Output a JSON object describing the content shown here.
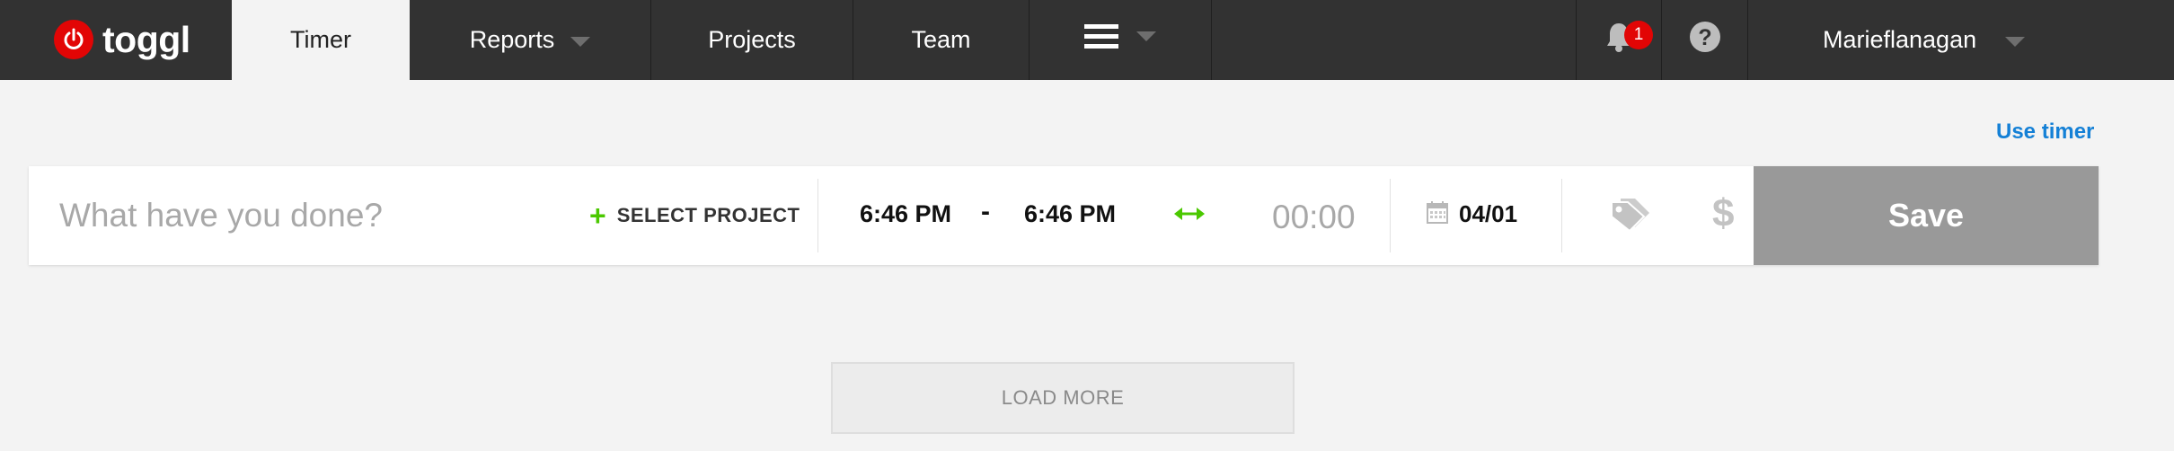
{
  "brand": {
    "name": "toggl",
    "logo_icon": "power-icon",
    "accent": "#e20505"
  },
  "nav": {
    "timer": "Timer",
    "reports": "Reports",
    "projects": "Projects",
    "team": "Team",
    "menu_icon": "hamburger-icon",
    "notifications_icon": "bell-icon",
    "notifications_count": "1",
    "help_icon": "question-icon",
    "user": "Marieflanagan"
  },
  "entry": {
    "use_timer_label": "Use timer",
    "description_placeholder": "What have you done?",
    "description_value": "",
    "select_project_label": "SELECT PROJECT",
    "start_time": "6:46 PM",
    "separator": "-",
    "end_time": "6:46 PM",
    "duration": "00:00",
    "date": "04/01",
    "save_label": "Save",
    "billable_label": "$"
  },
  "load_more_label": "LOAD MORE",
  "colors": {
    "nav_bg": "#323232",
    "link": "#1480d6",
    "green": "#4bc800",
    "save_bg": "#999999"
  }
}
